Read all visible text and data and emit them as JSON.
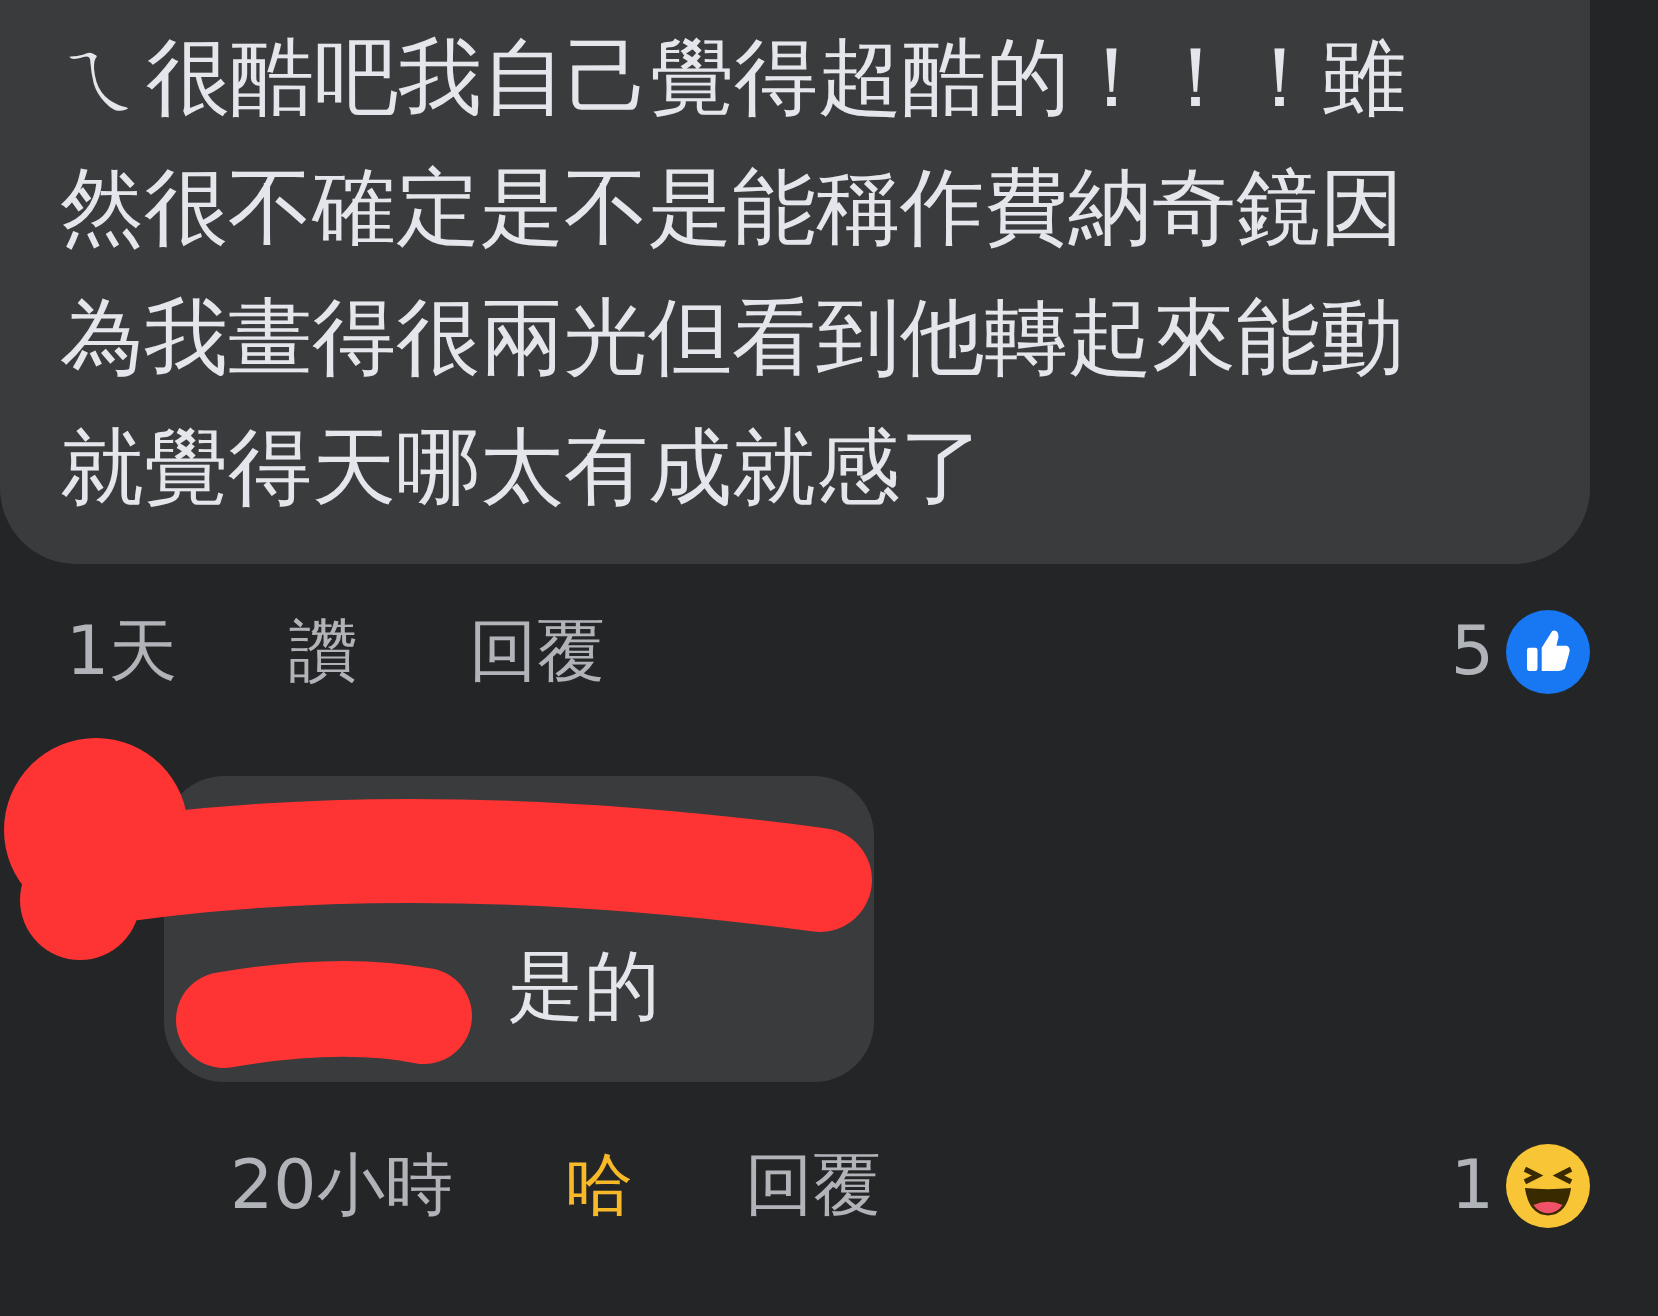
{
  "comment": {
    "text": "ㄟ很酷吧我自己覺得超酷的！！！雖然很不確定是不是能稱作費納奇鏡因為我畫得很兩光但看到他轉起來能動就覺得天哪太有成就感了",
    "time": "1天",
    "actions": [
      {
        "label": "讚",
        "active": false
      },
      {
        "label": "回覆",
        "active": false
      }
    ],
    "reaction": {
      "count": "5",
      "kind": "like"
    }
  },
  "reply": {
    "text": "是的",
    "time": "20小時",
    "actions": [
      {
        "label": "哈",
        "active": true
      },
      {
        "label": "回覆",
        "active": false
      }
    ],
    "reaction": {
      "count": "1",
      "kind": "haha"
    }
  }
}
